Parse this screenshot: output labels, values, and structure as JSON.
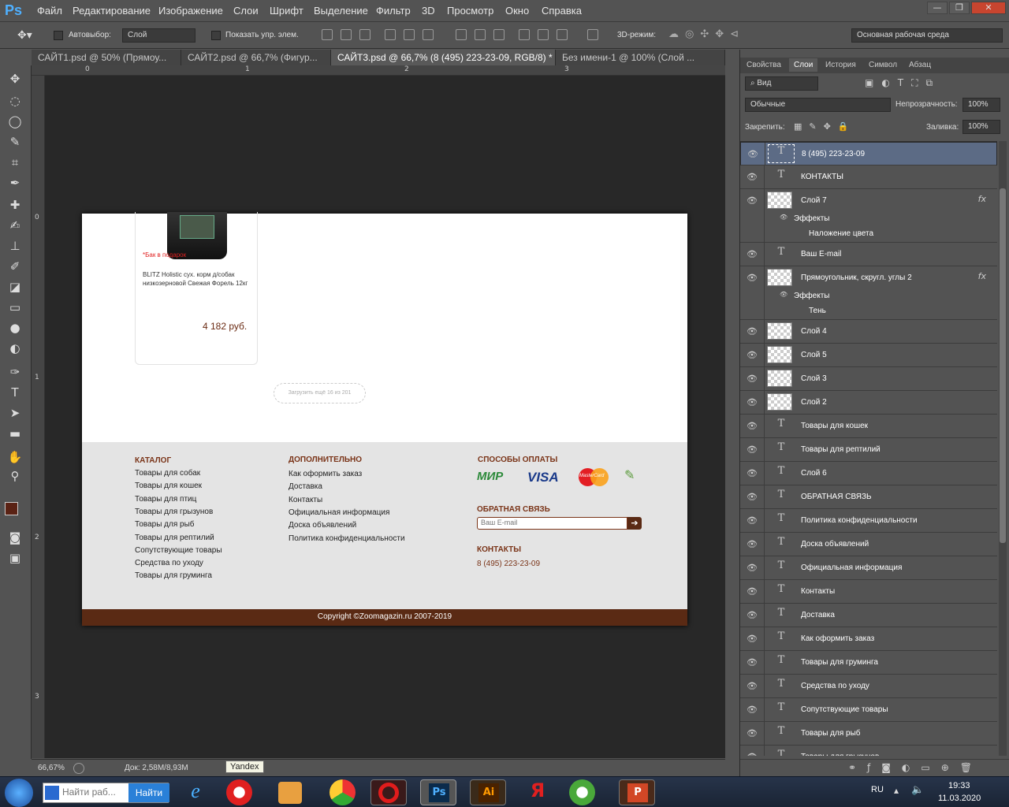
{
  "app": {
    "logo": "Ps"
  },
  "menu": [
    "Файл",
    "Редактирование",
    "Изображение",
    "Слои",
    "Шрифт",
    "Выделение",
    "Фильтр",
    "3D",
    "Просмотр",
    "Окно",
    "Справка"
  ],
  "window_controls": {
    "minimize": "—",
    "maximize": "❐",
    "close": "✕"
  },
  "options": {
    "autoselect_label": "Автовыбор:",
    "autoselect_value": "Слой",
    "show_controls_label": "Показать упр. элем.",
    "mode3d_label": "3D-режим:",
    "workspace": "Основная рабочая среда"
  },
  "doc_tabs": [
    {
      "label": "САЙТ1.psd @ 50% (Прямоу..."
    },
    {
      "label": "САЙТ2.psd @ 66,7% (Фигур..."
    },
    {
      "label": "САЙТ3.psd @ 66,7% (8 (495) 223-23-09, RGB/8) *"
    },
    {
      "label": "Без имени-1 @ 100% (Слой ..."
    }
  ],
  "ruler_top": [
    "0",
    "1",
    "2",
    "3"
  ],
  "ruler_left": [
    "0",
    "1",
    "2",
    "3"
  ],
  "page": {
    "product_badge": "*Бак в подарок",
    "product_name": "BLITZ Holistic сух. корм д/собак низкозерновой Свежая Форель 12кг",
    "product_price": "4 182 руб.",
    "load_more": "Загрузить ещё 16 из 201",
    "catalog_title": "КАТАЛОГ",
    "catalog_items": [
      "Товары для собак",
      "Товары для кошек",
      "Товары для птиц",
      "Товары для грызунов",
      "Товары для рыб",
      "Товары для рептилий",
      "Сопутствующие товары",
      "Средства по уходу",
      "Товары для груминга"
    ],
    "extra_title": "ДОПОЛНИТЕЛЬНО",
    "extra_items": [
      "Как оформить заказ",
      "Доставка",
      "Контакты",
      "Официальная информация",
      "Доска объявлений",
      "Политика конфиденциальности"
    ],
    "payment_title": "СПОСОБЫ ОПЛАТЫ",
    "payment_mir": "МИР",
    "payment_visa": "VISA",
    "payment_mc": "MasterCard",
    "feedback_title": "ОБРАТНАЯ СВЯЗЬ",
    "email_placeholder": "Ваш E-mail",
    "contacts_title": "КОНТАКТЫ",
    "phone": "8 (495) 223-23-09",
    "copyright": "Copyright ©Zoomagazin.ru 2007-2019"
  },
  "status": {
    "zoom": "66,67%",
    "doc": "Док: 2,58M/8,93M",
    "tooltip": "Yandex"
  },
  "panel_tabs": [
    "Свойства",
    "Слои",
    "История",
    "Символ",
    "Абзац"
  ],
  "layers_panel": {
    "filter": "Вид",
    "blend": "Обычные",
    "opacity_label": "Непрозрачность:",
    "opacity": "100%",
    "lock_label": "Закрепить:",
    "fill_label": "Заливка:",
    "fill": "100%"
  },
  "layers": [
    {
      "type": "text",
      "name": "8 (495) 223-23-09",
      "selected": true
    },
    {
      "type": "text",
      "name": "КОНТАКТЫ"
    },
    {
      "type": "pixel",
      "name": "Слой 7",
      "fx": true,
      "effects_label": "Эффекты",
      "effect": "Наложение цвета"
    },
    {
      "type": "text",
      "name": "Ваш E-mail"
    },
    {
      "type": "pixel",
      "name": "Прямоугольник, скругл. углы 2",
      "fx": true,
      "effects_label": "Эффекты",
      "effect": "Тень"
    },
    {
      "type": "pixel",
      "name": "Слой 4"
    },
    {
      "type": "pixel",
      "name": "Слой 5"
    },
    {
      "type": "pixel",
      "name": "Слой 3"
    },
    {
      "type": "pixel",
      "name": "Слой 2"
    },
    {
      "type": "text",
      "name": "Товары для кошек"
    },
    {
      "type": "text",
      "name": "Товары для рептилий"
    },
    {
      "type": "text",
      "name": "Слой 6"
    },
    {
      "type": "text",
      "name": "ОБРАТНАЯ СВЯЗЬ"
    },
    {
      "type": "text",
      "name": "Политика конфиденциальности"
    },
    {
      "type": "text",
      "name": "Доска объявлений"
    },
    {
      "type": "text",
      "name": "Официальная информация"
    },
    {
      "type": "text",
      "name": "Контакты"
    },
    {
      "type": "text",
      "name": "Доставка"
    },
    {
      "type": "text",
      "name": "Как оформить заказ"
    },
    {
      "type": "text",
      "name": "Товары для груминга"
    },
    {
      "type": "text",
      "name": "Средства по уходу"
    },
    {
      "type": "text",
      "name": "Сопутствующие товары"
    },
    {
      "type": "text",
      "name": "Товары для рыб"
    },
    {
      "type": "text",
      "name": "Товары для грызунов"
    }
  ],
  "taskbar": {
    "search_placeholder": "Найти раб...",
    "search_button": "Найти",
    "lang": "RU",
    "time": "19:33",
    "date": "11.03.2020"
  }
}
